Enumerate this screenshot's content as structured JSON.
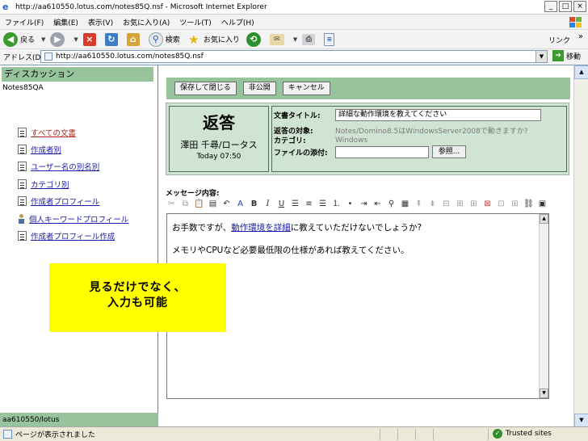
{
  "window": {
    "title": "http://aa610550.lotus.com/notes85Q.nsf - Microsoft Internet Explorer",
    "buttons": {
      "minimize": "_",
      "maximize": "□",
      "close": "×"
    }
  },
  "menu": [
    "ファイル(F)",
    "編集(E)",
    "表示(V)",
    "お気に入り(A)",
    "ツール(T)",
    "ヘルプ(H)"
  ],
  "toolbar": {
    "back": "戻る",
    "search": "検索",
    "favorites": "お気に入り",
    "links": "リンク"
  },
  "address": {
    "label": "アドレス(D)",
    "url": "http://aa610550.lotus.com/notes85Q.nsf",
    "go": "移動"
  },
  "nav": {
    "header": "ディスカッション",
    "app_name": "Notes85QA",
    "items": [
      "すべての文書",
      "作成者別",
      "ユーザー名の別名別",
      "カテゴリ別",
      "作成者プロフィール",
      "個人キーワードプロフィール",
      "作成者プロフィール作成"
    ],
    "footer": "aa610550/lotus"
  },
  "actions": [
    "保存して閉じる",
    "非公開",
    "キャンセル"
  ],
  "reply": {
    "title": "返答",
    "author": "澤田 千尋/ロータス",
    "time": "Today 07:50"
  },
  "meta": {
    "subject_label": "文書タイトル:",
    "subject_value": "詳細な動作環境を教えてください",
    "reply_to_label": "返答の対象:",
    "reply_to_value": "Notes/Domino8.5はWindowsServer2008で動きますか?",
    "category_label": "カテゴリ:",
    "category_value": "Windows",
    "attach_label": "ファイルの添付:",
    "browse": "参照..."
  },
  "editor": {
    "label": "メッセージ内容:",
    "line1_pre": "お手数ですが、",
    "line1_link": "動作環境を詳細",
    "line1_post": "に教えていただけないでしょうか?",
    "line2": "メモリやCPUなど必要最低限の仕様があれば教えてください。"
  },
  "callout": {
    "line1": "見るだけでなく、",
    "line2": "入力も可能"
  },
  "status": {
    "text": "ページが表示されました",
    "zone": "Trusted sites"
  },
  "colors": {
    "nav_header": "#97c49c",
    "form_bg": "#d0e4d3",
    "callout": "#ffff00",
    "link": "#1a1aa6"
  }
}
